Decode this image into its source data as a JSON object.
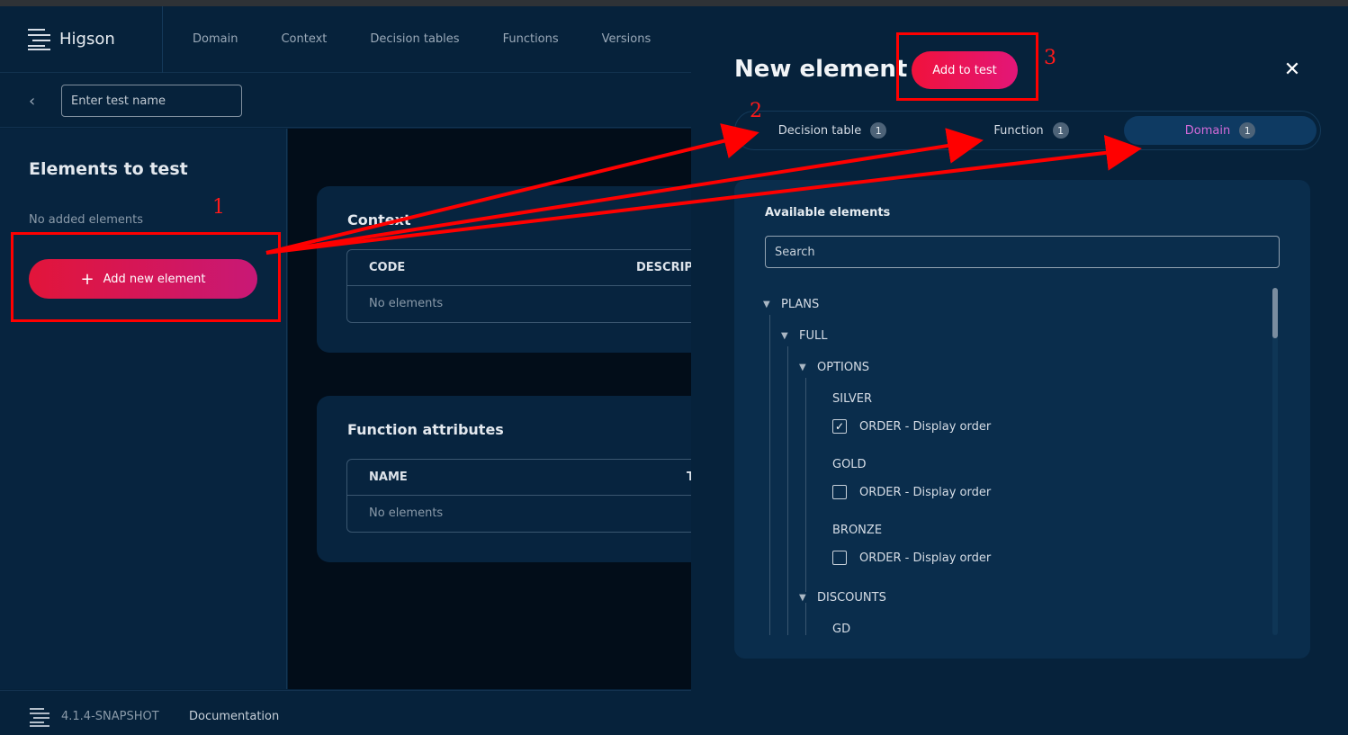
{
  "app": {
    "name": "Higson",
    "version": "4.1.4-SNAPSHOT",
    "docs_link": "Documentation"
  },
  "nav": [
    "Domain",
    "Context",
    "Decision tables",
    "Functions",
    "Versions"
  ],
  "test": {
    "name_placeholder": "Enter test name"
  },
  "sidebar": {
    "title": "Elements to test",
    "empty": "No added elements",
    "add_button": "Add new element"
  },
  "context_card": {
    "title": "Context",
    "col_code": "CODE",
    "col_desc": "DESCRIPT",
    "empty": "No elements"
  },
  "function_card": {
    "title": "Function attributes",
    "col_name": "NAME",
    "col_type": "T",
    "empty": "No elements"
  },
  "panel": {
    "title": "New element",
    "add_button": "Add to test",
    "tabs": [
      {
        "label": "Decision table",
        "count": "1"
      },
      {
        "label": "Function",
        "count": "1"
      },
      {
        "label": "Domain",
        "count": "1",
        "active": true
      }
    ],
    "available_title": "Available elements",
    "search_placeholder": "Search",
    "tree": {
      "plans": "PLANS",
      "full": "FULL",
      "options": "OPTIONS",
      "silver": "SILVER",
      "silver_item": "ORDER - Display order",
      "gold": "GOLD",
      "gold_item": "ORDER - Display order",
      "bronze": "BRONZE",
      "bronze_item": "ORDER - Display order",
      "discounts": "DISCOUNTS",
      "gd": "GD"
    }
  },
  "annotations": {
    "n1": "1",
    "n2": "2",
    "n3": "3"
  },
  "colors": {
    "accent": "#e2153a",
    "annotation": "#ff0000",
    "active_tab_text": "#d36ad8"
  }
}
